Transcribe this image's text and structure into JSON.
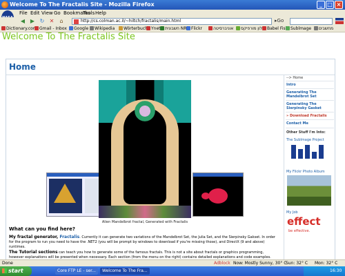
{
  "window": {
    "title": "Welcome To The Fractalis Site - Mozilla Firefox"
  },
  "menu": [
    "File",
    "Edit",
    "View",
    "Go",
    "Bookmarks",
    "Tools",
    "Help"
  ],
  "nav": {
    "url": "http://cs.colman.ac.il/~hiltch/fractalis/main.html",
    "go_label": "Go"
  },
  "bookmarks": [
    {
      "label": "Dictionary.com",
      "color": "#c33"
    },
    {
      "label": "Gmail - Inbox",
      "color": "#c33"
    },
    {
      "label": "Google",
      "color": "#3a6fd8"
    },
    {
      "label": "Wikipedia",
      "color": "#777"
    },
    {
      "label": "Wörterbuch",
      "color": "#c93"
    },
    {
      "label": "Ynet",
      "color": "#c33"
    },
    {
      "label": "חשבונית NRG",
      "color": "#2a7a2a"
    },
    {
      "label": "Flickr",
      "color": "#3a6fd8"
    },
    {
      "label": "אוניברסיטה",
      "color": "#c33"
    },
    {
      "label": "מילון מורפיקס",
      "color": "#6a3"
    },
    {
      "label": "Babel Fish",
      "color": "#c33"
    },
    {
      "label": "Sublmage",
      "color": "#5a5"
    },
    {
      "label": "מחשבים",
      "color": "#777"
    }
  ],
  "site": {
    "title": "Welcome To The Fractalis Site"
  },
  "main": {
    "heading": "Home",
    "caption": "Alien Mandelbrot fractal, Generated with Fractalis",
    "what_heading": "What can you find here?",
    "gen_lead": "My fractal generator, ",
    "gen_link": "Fractalis",
    "gen_text": ". Currently it can generate two variations of the Mandelbrot Set, the Julia Set, and the Sierpinsky Gakset. In order for the program to run you need to have the .NET2 (you will be prompt by windows to download if you're missing those), and DirectX (9 and above) runtimes.",
    "tut_lead": "The Tutorial sections",
    "tut_text": " can teach you how to generate some of the famous fractals. This is not a site about fractals or graphics programming, however explanations will be presented when necessary. Each section (from the menu on the right) contains detailed explanations and code examples."
  },
  "sidebar": {
    "home": "--> Home",
    "items": [
      {
        "label": "Intro"
      },
      {
        "label": "Generating The Mandelbrot Set"
      },
      {
        "label": "Generating The Sierpinsky Gasket"
      },
      {
        "label": "Download Fractalis"
      },
      {
        "label": "Contact Me"
      }
    ],
    "other_heading": "Other Stuff I'm Into:",
    "sublimage_label": "The SubImage Project",
    "flickr_label": "My Flickr Photo Album",
    "job_label": "My Job",
    "effect_logo": "effect",
    "effect_tagline": "be effective."
  },
  "status": {
    "left": "Done",
    "adblock": "Adblock",
    "weather_now": "Now: Mostly Sunny, 30° C",
    "sun": "Sun: 32° C",
    "mon": "Mon: 32° C"
  },
  "taskbar": {
    "start": "start",
    "buttons": [
      "Core FTP LE - ser...",
      "Welcome To The Fra..."
    ],
    "clock": "16:30"
  }
}
